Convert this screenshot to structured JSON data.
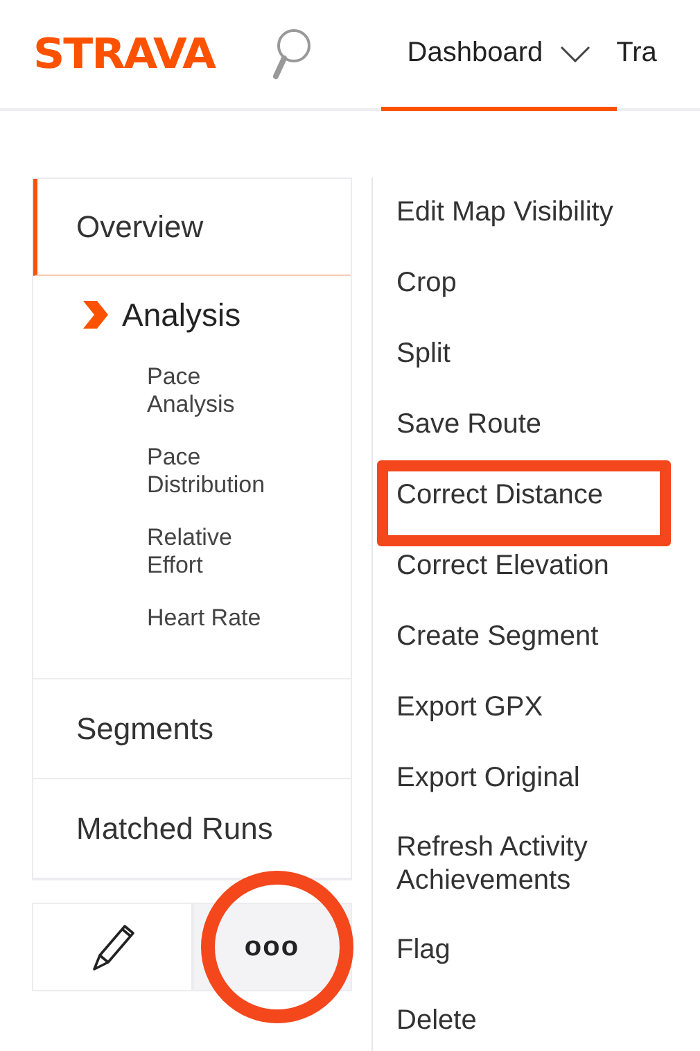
{
  "header": {
    "logo": "STRAVA",
    "nav": [
      {
        "label": "Dashboard",
        "selected": true,
        "dropdown": true
      },
      {
        "label": "Tra",
        "selected": false,
        "dropdown": false
      }
    ]
  },
  "sidebar": {
    "sections": [
      {
        "label": "Overview",
        "selected": true
      },
      {
        "label": "Analysis",
        "selected": false,
        "kind": "group",
        "children": [
          {
            "label": "Pace Analysis"
          },
          {
            "label": "Pace Distribution"
          },
          {
            "label": "Relative Effort"
          },
          {
            "label": "Heart Rate"
          }
        ]
      },
      {
        "label": "Segments",
        "selected": false
      },
      {
        "label": "Matched Runs",
        "selected": false
      }
    ],
    "actions": {
      "more_label": "ooo",
      "more_circled": true,
      "more_active": true
    }
  },
  "menu": [
    {
      "label": "Edit Map Visibility",
      "highlighted": false
    },
    {
      "label": "Crop",
      "highlighted": false
    },
    {
      "label": "Split",
      "highlighted": false
    },
    {
      "label": "Save Route",
      "highlighted": false
    },
    {
      "label": "Correct Distance",
      "highlighted": true
    },
    {
      "label": "Correct Elevation",
      "highlighted": false
    },
    {
      "label": "Create Segment",
      "highlighted": false
    },
    {
      "label": "Export GPX",
      "highlighted": false
    },
    {
      "label": "Export Original",
      "highlighted": false
    },
    {
      "label": "Refresh Activity Achievements",
      "highlighted": false
    },
    {
      "label": "Flag",
      "highlighted": false
    },
    {
      "label": "Delete",
      "highlighted": false
    }
  ]
}
